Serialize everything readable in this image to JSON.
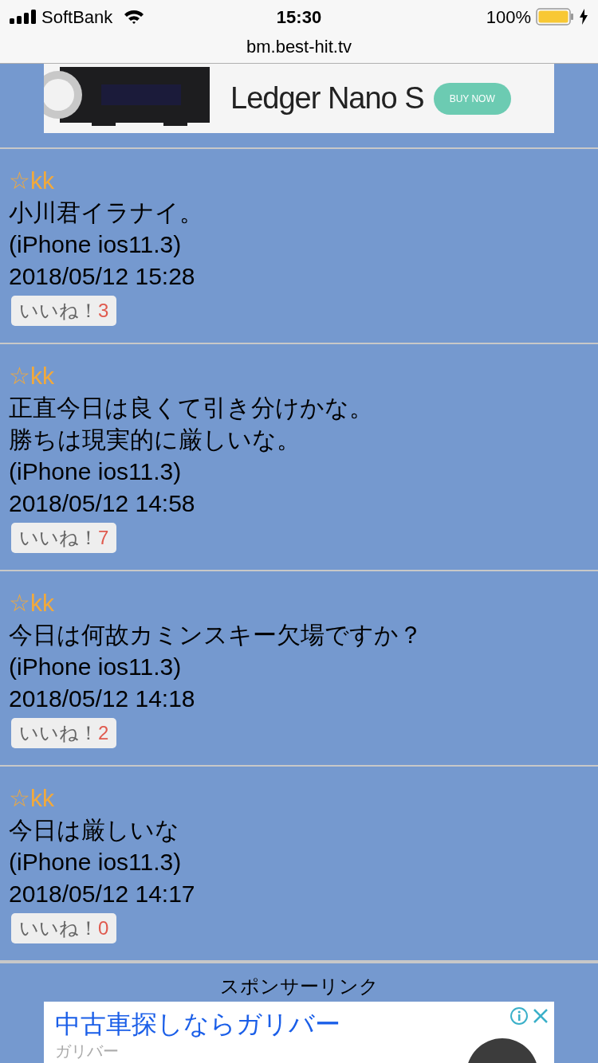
{
  "status_bar": {
    "carrier": "SoftBank",
    "time": "15:30",
    "battery": "100%"
  },
  "address_bar": {
    "url": "bm.best-hit.tv"
  },
  "top_ad": {
    "headline": "Ledger Nano S",
    "button": "BUY NOW"
  },
  "posts": [
    {
      "author": "☆kk",
      "lines": [
        "小川君イラナイ。"
      ],
      "device": "(iPhone ios11.3)",
      "date": "2018/05/12 15:28",
      "like_label": "いいね！",
      "like_count": "3"
    },
    {
      "author": "☆kk",
      "lines": [
        "正直今日は良くて引き分けかな。",
        "勝ちは現実的に厳しいな。"
      ],
      "device": "(iPhone ios11.3)",
      "date": "2018/05/12 14:58",
      "like_label": "いいね！",
      "like_count": "7"
    },
    {
      "author": "☆kk",
      "lines": [
        "今日は何故カミンスキー欠場ですか？"
      ],
      "device": "(iPhone ios11.3)",
      "date": "2018/05/12 14:18",
      "like_label": "いいね！",
      "like_count": "2"
    },
    {
      "author": "☆kk",
      "lines": [
        "今日は厳しいな"
      ],
      "device": "(iPhone ios11.3)",
      "date": "2018/05/12 14:17",
      "like_label": "いいね！",
      "like_count": "0"
    }
  ],
  "sponsor": {
    "label": "スポンサーリンク",
    "title": "中古車探しならガリバー",
    "advertiser": "ガリバー"
  }
}
